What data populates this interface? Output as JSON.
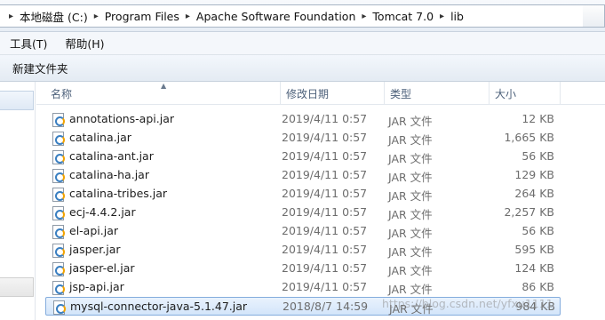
{
  "address": {
    "crumbs": [
      "本地磁盘 (C:)",
      "Program Files",
      "Apache Software Foundation",
      "Tomcat 7.0",
      "lib"
    ]
  },
  "menu": {
    "items": [
      "工具(T)",
      "帮助(H)"
    ]
  },
  "toolbar": {
    "new_folder_label": "新建文件夹"
  },
  "columns": {
    "name": "名称",
    "modified": "修改日期",
    "type": "类型",
    "size": "大小"
  },
  "files": [
    {
      "name": "annotations-api.jar",
      "modified": "2019/4/11 0:57",
      "type": "JAR 文件",
      "size": "12 KB"
    },
    {
      "name": "catalina.jar",
      "modified": "2019/4/11 0:57",
      "type": "JAR 文件",
      "size": "1,665 KB"
    },
    {
      "name": "catalina-ant.jar",
      "modified": "2019/4/11 0:57",
      "type": "JAR 文件",
      "size": "56 KB"
    },
    {
      "name": "catalina-ha.jar",
      "modified": "2019/4/11 0:57",
      "type": "JAR 文件",
      "size": "129 KB"
    },
    {
      "name": "catalina-tribes.jar",
      "modified": "2019/4/11 0:57",
      "type": "JAR 文件",
      "size": "264 KB"
    },
    {
      "name": "ecj-4.4.2.jar",
      "modified": "2019/4/11 0:57",
      "type": "JAR 文件",
      "size": "2,257 KB"
    },
    {
      "name": "el-api.jar",
      "modified": "2019/4/11 0:57",
      "type": "JAR 文件",
      "size": "56 KB"
    },
    {
      "name": "jasper.jar",
      "modified": "2019/4/11 0:57",
      "type": "JAR 文件",
      "size": "595 KB"
    },
    {
      "name": "jasper-el.jar",
      "modified": "2019/4/11 0:57",
      "type": "JAR 文件",
      "size": "124 KB"
    },
    {
      "name": "jsp-api.jar",
      "modified": "2019/4/11 0:57",
      "type": "JAR 文件",
      "size": "86 KB"
    },
    {
      "name": "mysql-connector-java-5.1.47.jar",
      "modified": "2018/8/7 14:59",
      "type": "JAR 文件",
      "size": "984 KB",
      "selected": true
    }
  ],
  "watermark": "https://blog.csdn.net/yfxu1111"
}
